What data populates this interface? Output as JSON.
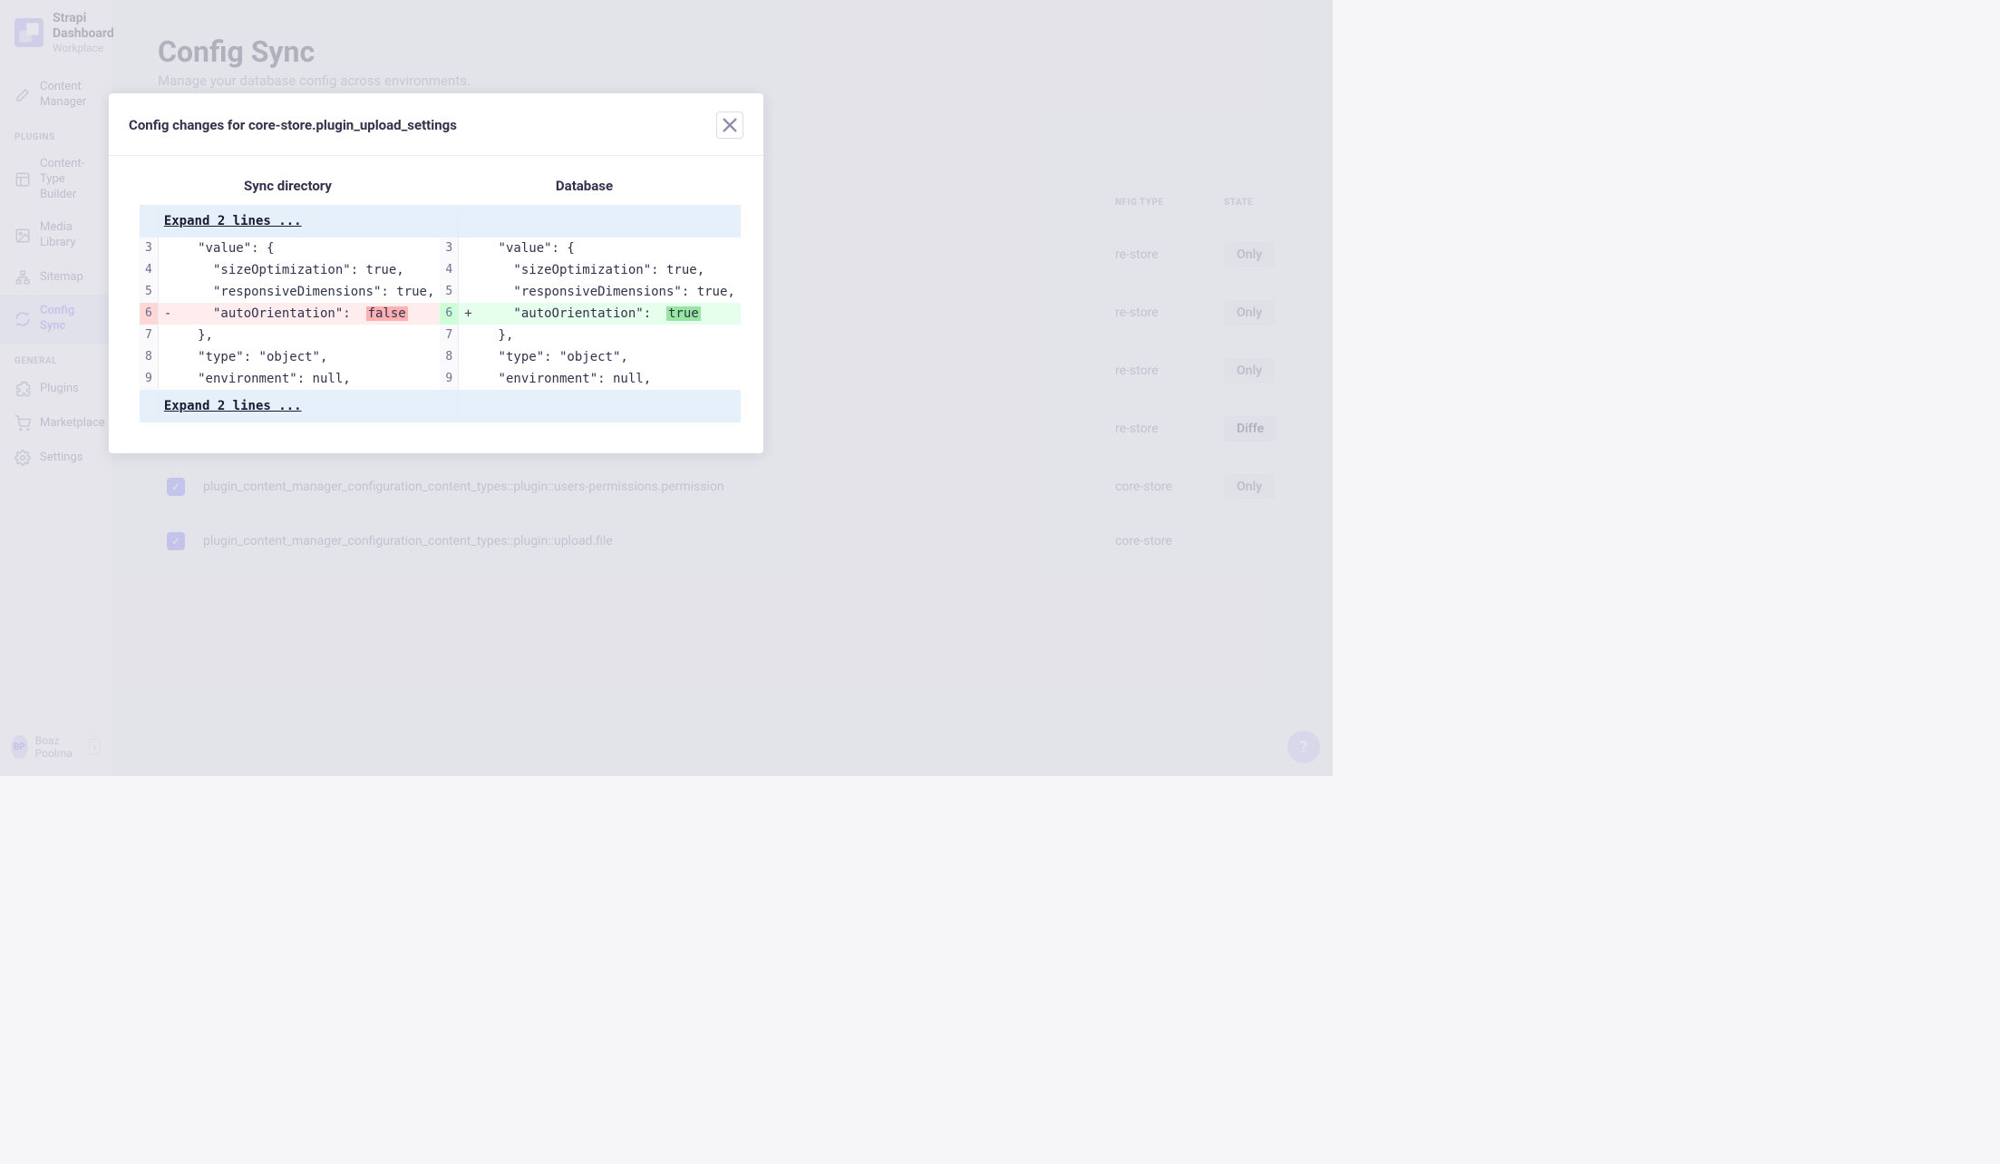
{
  "brand": {
    "title": "Strapi Dashboard",
    "subtitle": "Workplace"
  },
  "nav": {
    "content_manager": "Content Manager",
    "plugins_label": "PLUGINS",
    "content_type_builder": "Content-Type Builder",
    "media_library": "Media Library",
    "sitemap": "Sitemap",
    "config_sync": "Config Sync",
    "general_label": "GENERAL",
    "plugins": "Plugins",
    "marketplace": "Marketplace",
    "settings": "Settings"
  },
  "user": {
    "initials": "BP",
    "name": "Boaz Poolma"
  },
  "page": {
    "title": "Config Sync",
    "subtitle": "Manage your database config across environments."
  },
  "table": {
    "headers": {
      "config_type": "NFIG TYPE",
      "state": "STATE"
    },
    "rows": [
      {
        "name": "",
        "type": "re-store",
        "state": "Only"
      },
      {
        "name": "",
        "type": "re-store",
        "state": "Only"
      },
      {
        "name": "",
        "type": "re-store",
        "state": "Only"
      },
      {
        "name": "",
        "type": "re-store",
        "state": "Diffe"
      },
      {
        "name": "plugin_content_manager_configuration_content_types::plugin::users-permissions.permission",
        "type": "core-store",
        "state": "Only"
      },
      {
        "name": "plugin_content_manager_configuration_content_types::plugin::upload.file",
        "type": "core-store",
        "state": ""
      }
    ]
  },
  "modal": {
    "title": "Config changes for core-store.plugin_upload_settings",
    "left_header": "Sync directory",
    "right_header": "Database",
    "expand_top": "Expand 2 lines ...",
    "expand_bottom": "Expand 2 lines ...",
    "lines": {
      "l3": {
        "n": "3",
        "code": "  \"value\": {"
      },
      "l4": {
        "n": "4",
        "code": "    \"sizeOptimization\": true,"
      },
      "l5": {
        "n": "5",
        "code": "    \"responsiveDimensions\": true,"
      },
      "l6_left_pre": "    \"autoOrientation\":  ",
      "l6_left_hl": "false",
      "l6_n": "6",
      "l6_right_pre": "    \"autoOrientation\":  ",
      "l6_right_hl": "true",
      "l7": {
        "n": "7",
        "code": "  },"
      },
      "l8": {
        "n": "8",
        "code": "  \"type\": \"object\","
      },
      "l9": {
        "n": "9",
        "code": "  \"environment\": null,"
      }
    }
  },
  "help": "?"
}
